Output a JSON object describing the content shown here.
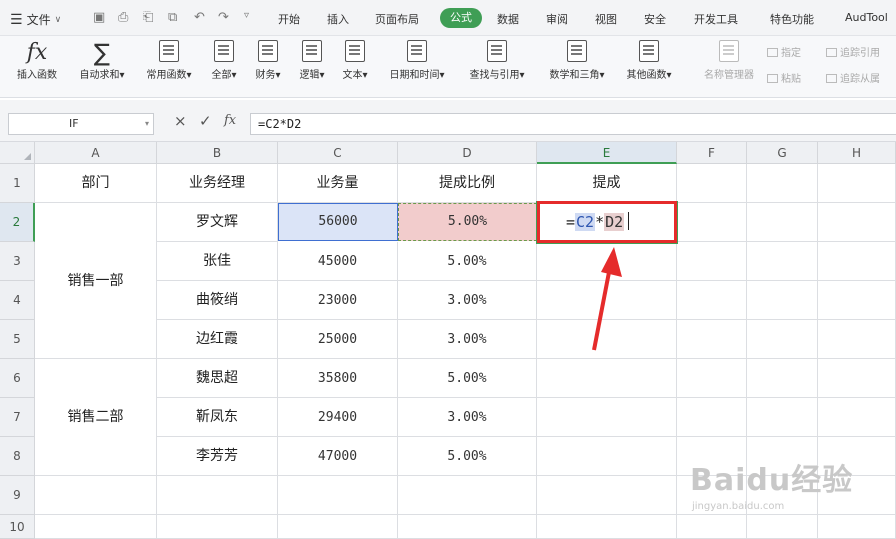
{
  "menubar": {
    "file_label": "文件",
    "tabs": [
      "开始",
      "插入",
      "页面布局",
      "公式",
      "数据",
      "审阅",
      "视图",
      "安全",
      "开发工具",
      "特色功能",
      "AudTool"
    ],
    "active_tab": "公式"
  },
  "ribbon": {
    "insert_function": "插入函数",
    "autosum": "自动求和",
    "common_functions": "常用函数",
    "all": "全部",
    "finance": "财务",
    "logic": "逻辑",
    "text": "文本",
    "datetime": "日期和时间",
    "lookup": "查找与引用",
    "math": "数学和三角",
    "other": "其他函数",
    "name_manager": "名称管理器",
    "paste": "粘贴",
    "specify": "指定",
    "trace_precedents": "追踪引用",
    "trace_dependents": "追踪从属"
  },
  "formula_bar": {
    "name_box": "IF",
    "formula": "=C2*D2",
    "cancel_symbol": "×",
    "confirm_symbol": "✓",
    "fx_symbol": "fx"
  },
  "columns": [
    "A",
    "B",
    "C",
    "D",
    "E",
    "F",
    "G",
    "H"
  ],
  "rows": [
    "1",
    "2",
    "3",
    "4",
    "5",
    "6",
    "7",
    "8",
    "9",
    "10"
  ],
  "headers": {
    "dept": "部门",
    "manager": "业务经理",
    "volume": "业务量",
    "rate": "提成比例",
    "commission": "提成"
  },
  "dept_groups": [
    "销售一部",
    "销售二部"
  ],
  "data_rows": [
    {
      "manager": "罗文辉",
      "volume": "56000",
      "rate": "5.00%"
    },
    {
      "manager": "张佳",
      "volume": "45000",
      "rate": "5.00%"
    },
    {
      "manager": "曲筱绡",
      "volume": "23000",
      "rate": "3.00%"
    },
    {
      "manager": "边红霞",
      "volume": "25000",
      "rate": "3.00%"
    },
    {
      "manager": "魏思超",
      "volume": "35800",
      "rate": "5.00%"
    },
    {
      "manager": "靳凤东",
      "volume": "29400",
      "rate": "3.00%"
    },
    {
      "manager": "李芳芳",
      "volume": "47000",
      "rate": "5.00%"
    }
  ],
  "edit_cell": {
    "eq": "=",
    "ref1": "C2",
    "op": "*",
    "ref2": "D2"
  },
  "watermark": {
    "brand": "Baidu经验",
    "url": "jingyan.baidu.com"
  },
  "colors": {
    "accent": "#3f9e55",
    "highlight_red": "#e52b2b",
    "c2_fill": "#dbe4f7",
    "d2_fill": "#f2cccc"
  }
}
